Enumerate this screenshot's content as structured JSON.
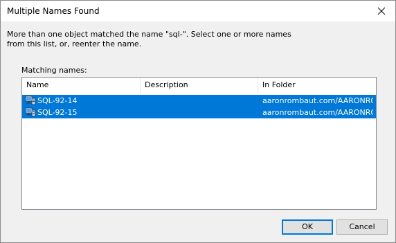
{
  "window": {
    "title": "Multiple Names Found"
  },
  "message": {
    "line1": "More than one object matched the name \"sql-\". Select one or more names",
    "line2": "from this list, or, reenter the name."
  },
  "list": {
    "label": "Matching names:",
    "columns": [
      "Name",
      "Description",
      "In Folder"
    ],
    "rows": [
      {
        "name": "SQL-92-14",
        "description": "",
        "folder": "aaronrombaut.com/AARONRO...",
        "icon": "computer-icon",
        "selected": true
      },
      {
        "name": "SQL-92-15",
        "description": "",
        "folder": "aaronrombaut.com/AARONRO...",
        "icon": "computer-icon",
        "selected": true
      }
    ]
  },
  "buttons": {
    "ok": "OK",
    "cancel": "Cancel"
  },
  "colors": {
    "selection": "#0078d7",
    "window_bg": "#f0f0f0",
    "titlebar_bg": "#ffffff"
  }
}
